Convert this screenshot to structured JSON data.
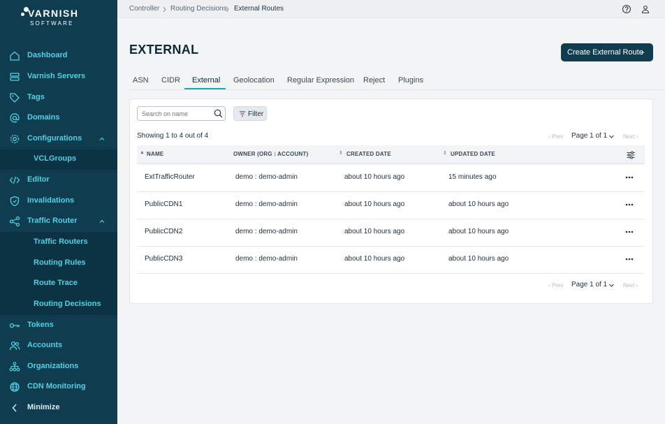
{
  "logo": {
    "line1": "VARNISH",
    "line2": "SOFTWARE"
  },
  "sidebar": {
    "items": [
      {
        "label": "Dashboard",
        "icon": "home-icon"
      },
      {
        "label": "Varnish Servers",
        "icon": "server-icon"
      },
      {
        "label": "Tags",
        "icon": "tag-icon"
      },
      {
        "label": "Domains",
        "icon": "at-icon"
      },
      {
        "label": "Configurations",
        "icon": "gear-icon"
      },
      {
        "label": "VCLGroups"
      },
      {
        "label": "Editor",
        "icon": "code-icon"
      },
      {
        "label": "Invalidations",
        "icon": "shield-icon"
      },
      {
        "label": "Traffic Router",
        "icon": "share-icon"
      },
      {
        "label": "Traffic Routers"
      },
      {
        "label": "Routing Rules"
      },
      {
        "label": "Route Trace"
      },
      {
        "label": "Routing Decisions"
      },
      {
        "label": "Tokens",
        "icon": "key-icon"
      },
      {
        "label": "Accounts",
        "icon": "users-icon"
      },
      {
        "label": "Organizations",
        "icon": "org-icon"
      },
      {
        "label": "CDN Monitoring",
        "icon": "globe-icon"
      }
    ],
    "minimize": "Minimize"
  },
  "breadcrumb": {
    "items": [
      "Controller",
      "Routing Decisions",
      "External Routes"
    ],
    "separator": ">"
  },
  "header": {
    "title": "EXTERNAL",
    "create_button": "Create External Route",
    "create_plus": "+"
  },
  "tabs": [
    "ASN",
    "CIDR",
    "External",
    "Geolocation",
    "Regular Expression",
    "Reject",
    "Plugins"
  ],
  "active_tab": "External",
  "toolbar": {
    "search_placeholder": "Search on name",
    "filter_label": "Filter"
  },
  "table": {
    "showing": "Showing 1 to 4 out of 4",
    "pagination": {
      "prev": "‹ Prev",
      "next": "Next ›",
      "page": "Page 1 of 1"
    },
    "sort_marker_asc": "▲",
    "sort_marker_both": "⇕",
    "columns": [
      "NAME",
      "OWNER (ORG : ACCOUNT)",
      "CREATED DATE",
      "UPDATED DATE"
    ],
    "rows": [
      {
        "name": "ExtTrafficRouter",
        "owner": "demo : demo-admin",
        "created": "about 10 hours ago",
        "updated": "15 minutes ago"
      },
      {
        "name": "PublicCDN1",
        "owner": "demo : demo-admin",
        "created": "about 10 hours ago",
        "updated": "about 10 hours ago"
      },
      {
        "name": "PublicCDN2",
        "owner": "demo : demo-admin",
        "created": "about 10 hours ago",
        "updated": "about 10 hours ago"
      },
      {
        "name": "PublicCDN3",
        "owner": "demo : demo-admin",
        "created": "about 10 hours ago",
        "updated": "about 10 hours ago"
      }
    ]
  },
  "colors": {
    "sidebar_bg": "#0f3d4f",
    "accent": "#4fd1e6",
    "tab_underline": "#1fa3b8",
    "button_bg": "#0f3d4f"
  }
}
